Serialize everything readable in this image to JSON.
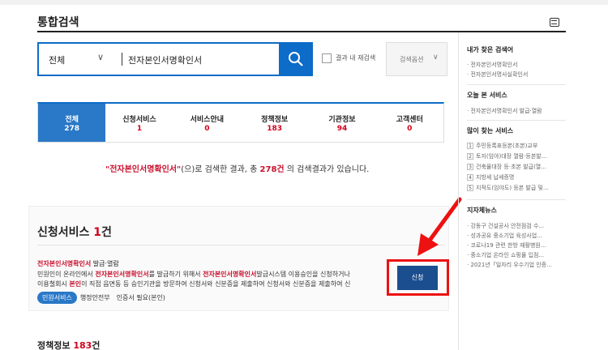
{
  "header": {
    "title": "통합검색"
  },
  "search": {
    "scope": "전체",
    "query": "전자본인서명확인서",
    "recheck_label": "결과 내 재검색",
    "options_label": "검색옵션"
  },
  "tabs": [
    {
      "label": "전체",
      "count": "278"
    },
    {
      "label": "신청서비스",
      "count": "1"
    },
    {
      "label": "서비스안내",
      "count": "0"
    },
    {
      "label": "정책정보",
      "count": "183"
    },
    {
      "label": "기관정보",
      "count": "94"
    },
    {
      "label": "고객센터",
      "count": "0"
    }
  ],
  "summary": {
    "query_quoted": "\"전자본인서명확인서\"",
    "text1": "(으)로 검색한 결과, 총 ",
    "total": "278건",
    "text2": " 의 검색결과가 있습니다."
  },
  "sections": {
    "apply": {
      "title": "신청서비스",
      "count": "1",
      "unit": "건"
    },
    "policy": {
      "title": "정책정보",
      "count": "183",
      "unit": "건"
    }
  },
  "result": {
    "title_hl": "전자본인서명확인서",
    "title_rest": " 발급·열람",
    "desc_a": "민원인이 온라인에서 ",
    "desc_hl1": "전자본인서명확인서",
    "desc_b": "를 발급하기 위해서 ",
    "desc_hl2": "전자본인서명확인서",
    "desc_c": "발급시스템 이용승인을 신청하거나",
    "desc_d": "이용철회시 ",
    "desc_hl3": "본인",
    "desc_e": "이 직접 읍면동 등 승인기관을 방문하여 신청서와 신분증을 제출하여 신청서와 신분증을 제출하여 신",
    "tag_pill": "민원서비스",
    "tag_agency": "행정안전부",
    "tag_cert": "인증서 필요(본인)",
    "apply_label": "신청"
  },
  "sidebar": {
    "recent_title": "내가 찾은 검색어",
    "recent": [
      "전자본인서명확인서",
      "전자본인서명사실확인서"
    ],
    "today_title": "오늘 본 서비스",
    "today": [
      "전자본인서명확인서 발급·열람"
    ],
    "popular_title": "많이 찾는 서비스",
    "popular": [
      {
        "num": "1",
        "label": "주민등록표등본(초본)교부"
      },
      {
        "num": "2",
        "label": "토지(임야)대장 열람·등본발..."
      },
      {
        "num": "3",
        "label": "건축물대장 등·초본 발급(열..."
      },
      {
        "num": "4",
        "label": "지방세 납세증명"
      },
      {
        "num": "5",
        "label": "지적도(임야도) 등본 발급 및..."
      }
    ],
    "news_title": "지자체뉴스",
    "news": [
      "강동구 건설공사 안전점검 수...",
      "성과공유 중소기업 육성사업...",
      "코로나19 관련 한방 재활병원...",
      "중소기업 온라인 쇼핑몰 입점...",
      "2021년「일자리 우수기업 인증..."
    ]
  },
  "colors": {
    "accent": "#0c6cc7",
    "highlight": "#c8102e",
    "annotation": "#e11111"
  }
}
